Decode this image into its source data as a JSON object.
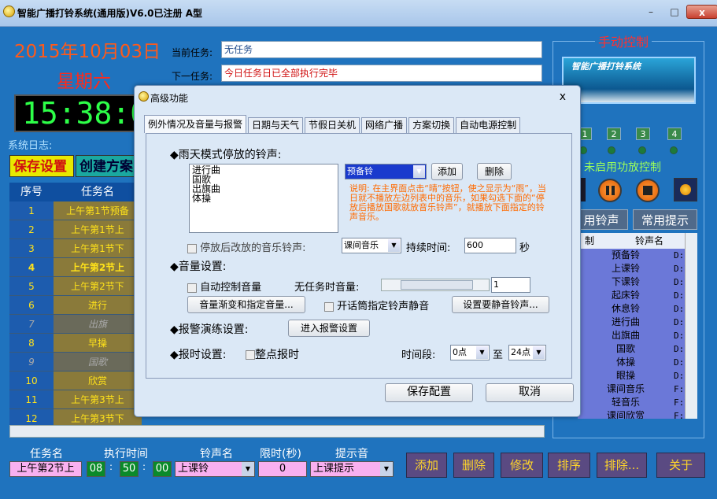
{
  "window": {
    "title": "智能广播打铃系统(通用版)V6.0已注册 A型",
    "min_label": "–",
    "max_label": "□",
    "close_label": "x"
  },
  "header": {
    "date": "2015年10月03日",
    "weekday": "星期六",
    "clock": "15:38:07",
    "current_task_label": "当前任务:",
    "current_task_value": "无任务",
    "next_task_label": "下一任务:",
    "next_task_value": "今日任务日已全部执行完毕",
    "syslog_label": "系统日志:",
    "save_btn": "保存设置",
    "create_btn": "创建方案"
  },
  "task_table": {
    "headers": [
      "序号",
      "任务名"
    ],
    "rows": [
      {
        "no": "1",
        "name": "上午第1节预备"
      },
      {
        "no": "2",
        "name": "上午第1节上"
      },
      {
        "no": "3",
        "name": "上午第1节下"
      },
      {
        "no": "4",
        "name": "上午第2节上"
      },
      {
        "no": "5",
        "name": "上午第2节下"
      },
      {
        "no": "6",
        "name": "进行"
      },
      {
        "no": "7",
        "name": "出旗"
      },
      {
        "no": "8",
        "name": "早操"
      },
      {
        "no": "9",
        "name": "国歌"
      },
      {
        "no": "10",
        "name": "欣赏"
      },
      {
        "no": "11",
        "name": "上午第3节上"
      },
      {
        "no": "12",
        "name": "上午第3节下"
      }
    ]
  },
  "right_panel": {
    "title": "手动控制",
    "banner_text": "智能广播打铃系统",
    "numbers": [
      "1",
      "2",
      "3",
      "4"
    ],
    "status": "未启用功放控制",
    "tab_ring": "用铃声",
    "tab_tip": "常用提示",
    "ring_headers": [
      "制",
      "铃声名"
    ],
    "rings": [
      {
        "name": "预备铃",
        "path": "D:\\"
      },
      {
        "name": "上课铃",
        "path": "D:\\"
      },
      {
        "name": "下课铃",
        "path": "D:\\"
      },
      {
        "name": "起床铃",
        "path": "D:\\"
      },
      {
        "name": "休息铃",
        "path": "D:\\"
      },
      {
        "name": "进行曲",
        "path": "D:\\"
      },
      {
        "name": "出旗曲",
        "path": "D:\\"
      },
      {
        "name": "国歌",
        "path": "D:\\"
      },
      {
        "name": "体操",
        "path": "D:\\"
      },
      {
        "name": "眼操",
        "path": "D:\\"
      },
      {
        "name": "课间音乐",
        "path": "F:\\"
      },
      {
        "name": "轻音乐",
        "path": "F:\\"
      },
      {
        "name": "课间欣赏",
        "path": "F:\\"
      }
    ]
  },
  "bottom": {
    "task_label": "任务名",
    "time_label": "执行时间",
    "ring_label": "铃声名",
    "limit_label": "限时(秒)",
    "tip_label": "提示音",
    "task_value": "上午第2节上",
    "hh": "08",
    "mm": "50",
    "ss": "00",
    "ring_value": "上课铃",
    "limit_value": "0",
    "tip_value": "上课提示",
    "buttons": [
      "添加",
      "删除",
      "修改",
      "排序",
      "排除...",
      "关于"
    ]
  },
  "dialog": {
    "title": "高级功能",
    "close": "x",
    "tabs": [
      "例外情况及音量与报警",
      "日期与天气",
      "节假日关机",
      "网络广播",
      "方案切换",
      "自动电源控制"
    ],
    "rain_title": "◆雨天模式停放的铃声:",
    "rain_list": [
      "进行曲",
      "国歌",
      "出旗曲",
      "体操"
    ],
    "rain_select": "预备铃",
    "add": "添加",
    "delete": "删除",
    "note": "说明: 在主界面点击“晴”按钮，使之显示为“雨”，当日就不播放左边列表中的音乐，如果勾选下面的“停放后播放国歌就放音乐铃声”，就播放下面指定的铃声音乐。",
    "replace_label": "停放后改放的音乐铃声:",
    "replace_select": "课间音乐",
    "duration_label": "持续时间:",
    "duration_value": "600",
    "sec": "秒",
    "volume_title": "◆音量设置:",
    "auto_volume": "自动控制音量",
    "idle_volume_label": "无任务时音量:",
    "idle_volume_value": "1",
    "fade_btn": "音量渐变和指定音量...",
    "mic_mute": "开话筒指定铃声静音",
    "mute_btn": "设置要静音铃声...",
    "alarm_title": "◆报警演练设置:",
    "alarm_btn": "进入报警设置",
    "report_title": "◆报时设置:",
    "hourly": "整点报时",
    "period_label": "时间段:",
    "from": "0点",
    "to_label": "至",
    "to": "24点",
    "save": "保存配置",
    "cancel": "取消"
  }
}
